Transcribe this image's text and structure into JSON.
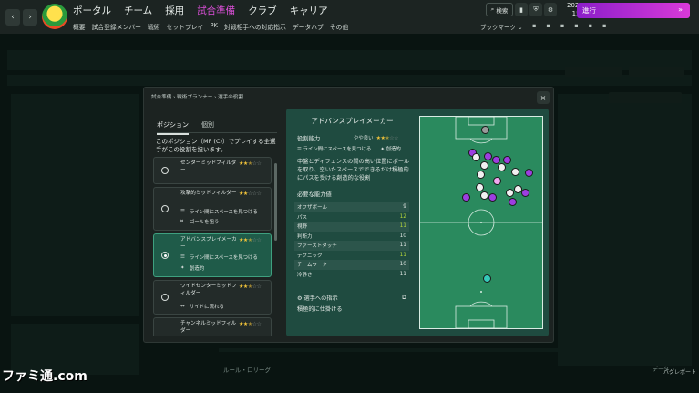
{
  "topbar": {
    "nav": [
      "ポータル",
      "チーム",
      "採用",
      "試合準備",
      "クラブ",
      "キャリア"
    ],
    "subnav": [
      "概要",
      "試合登録メンバー",
      "戦術",
      "セットプレイ",
      "PK",
      "対戦相手への対応指示",
      "データハブ",
      "その他"
    ],
    "search_label": "検索",
    "date": "2025/3/1",
    "time": "15:45",
    "advance_label": "進行",
    "bookmark_label": "ブックマーク"
  },
  "modal": {
    "breadcrumb": "試合準備 › 戦術プランナー › 選手の役割",
    "close_label": "×",
    "tabs": [
      "ポジション",
      "個別"
    ],
    "description": "このポジション（MF (C)）でプレイする全選手がこの役割を担います。",
    "roles": [
      {
        "name": "センターミッドフィルダー",
        "stars_on": 2,
        "stars_half": 1,
        "stars_total": 5,
        "keys": []
      },
      {
        "name": "攻撃的ミッドフィルダー",
        "stars_on": 2,
        "stars_half": 0,
        "stars_total": 5,
        "keys": [
          "ライン間にスペースを見つける",
          "ゴールを狙う"
        ]
      },
      {
        "name": "アドバンスプレイメーカー",
        "stars_on": 2,
        "stars_half": 1,
        "stars_total": 5,
        "keys": [
          "ライン間にスペースを見つける",
          "創造的"
        ],
        "selected": true
      },
      {
        "name": "ワイドセンターミッドフィルダー",
        "stars_on": 2,
        "stars_half": 1,
        "stars_total": 5,
        "keys": [
          "サイドに流れる"
        ]
      },
      {
        "name": "チャンネルミッドフィルダー",
        "stars_on": 2,
        "stars_half": 1,
        "stars_total": 5,
        "keys": []
      }
    ],
    "detail": {
      "title": "アドバンスプレイメーカー",
      "capability_label": "役割能力",
      "capability_value": "やや良い",
      "keys": [
        "ライン間にスペースを見つける",
        "創造的"
      ],
      "description": "中盤とディフェンスの間の高い位置にボールを取り、空いたスペースでできるだけ積極的にパスを受ける創造的な役割",
      "attributes_label": "必要な能力値",
      "attributes": [
        {
          "name": "オフザボール",
          "value": "9",
          "highlight": false
        },
        {
          "name": "パス",
          "value": "12",
          "highlight": true
        },
        {
          "name": "視野",
          "value": "11",
          "highlight": true
        },
        {
          "name": "判断力",
          "value": "10",
          "highlight": false
        },
        {
          "name": "ファーストタッチ",
          "value": "11",
          "highlight": false
        },
        {
          "name": "テクニック",
          "value": "11",
          "highlight": true
        },
        {
          "name": "チームワーク",
          "value": "10",
          "highlight": false
        },
        {
          "name": "冷静さ",
          "value": "11",
          "highlight": false
        }
      ],
      "instructions_label": "選手への指示",
      "instructions_value": "積極的に仕掛ける"
    }
  },
  "footer": {
    "watermark": "ファミ通.com",
    "right_label": "バグレポート",
    "left_dim": "ルール・ロリーグ",
    "right_dim": "データ"
  },
  "colors": {
    "accent": "#d94fd6",
    "selected_role": "#1f5b49",
    "detail_panel": "#1f4b40",
    "pitch": "#2a8a5e",
    "player_purple": "#9c3ee0",
    "player_highlight": "#f3a8f0",
    "star": "#f0c23a"
  }
}
